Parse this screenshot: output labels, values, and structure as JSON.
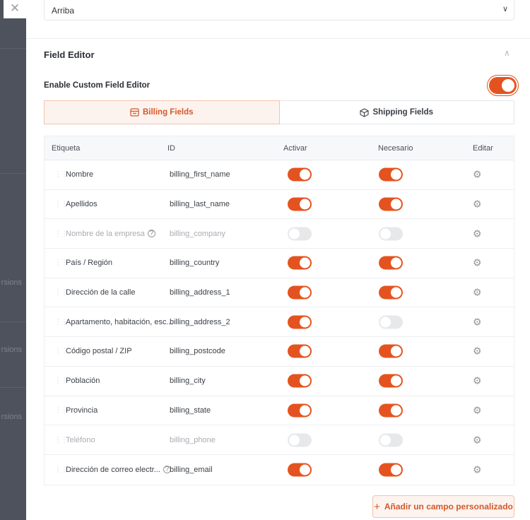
{
  "backdrop": {
    "fragments": [
      "rsions",
      "rsions",
      "rsions"
    ]
  },
  "position_select": {
    "value": "Arriba"
  },
  "field_editor": {
    "title": "Field Editor",
    "enable_label": "Enable Custom Field Editor",
    "enabled": true,
    "tabs": [
      {
        "label": "Billing Fields",
        "icon": "billing-card-icon",
        "active": true
      },
      {
        "label": "Shipping Fields",
        "icon": "box-icon",
        "active": false
      }
    ],
    "columns": [
      "Etiqueta",
      "ID",
      "Activar",
      "Necesario",
      "Editar"
    ],
    "rows": [
      {
        "label": "Nombre",
        "id": "billing_first_name",
        "active": true,
        "required": true,
        "help": false
      },
      {
        "label": "Apellidos",
        "id": "billing_last_name",
        "active": true,
        "required": true,
        "help": false
      },
      {
        "label": "Nombre de la empresa",
        "id": "billing_company",
        "active": false,
        "required": false,
        "help": true
      },
      {
        "label": "País / Región",
        "id": "billing_country",
        "active": true,
        "required": true,
        "help": false
      },
      {
        "label": "Dirección de la calle",
        "id": "billing_address_1",
        "active": true,
        "required": true,
        "help": false
      },
      {
        "label": "Apartamento, habitación, esc...",
        "id": "billing_address_2",
        "active": true,
        "required": false,
        "help": false
      },
      {
        "label": "Código postal / ZIP",
        "id": "billing_postcode",
        "active": true,
        "required": true,
        "help": false
      },
      {
        "label": "Población",
        "id": "billing_city",
        "active": true,
        "required": true,
        "help": false
      },
      {
        "label": "Provincia",
        "id": "billing_state",
        "active": true,
        "required": true,
        "help": false
      },
      {
        "label": "Teléfono",
        "id": "billing_phone",
        "active": false,
        "required": false,
        "help": false
      },
      {
        "label": "Dirección de correo electr...",
        "id": "billing_email",
        "active": true,
        "required": true,
        "help": true
      }
    ],
    "add_button": "Añadir un campo personalizado"
  },
  "colors": {
    "accent": "#e4531f",
    "toggle_off": "#e7e8ea"
  }
}
